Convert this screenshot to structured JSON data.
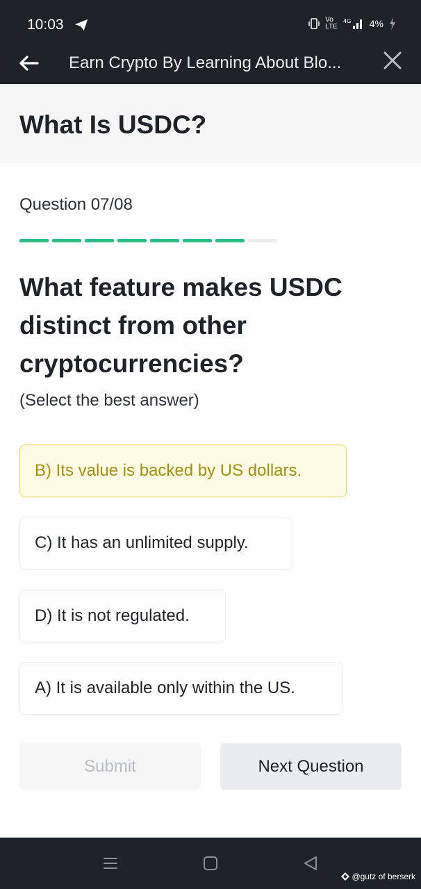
{
  "status_bar": {
    "time": "10:03",
    "indicators": "Ⅱ ⓥ ⁴ᴳ ▕▏",
    "battery": "4%"
  },
  "top_bar": {
    "title": "Earn Crypto By Learning About Blo..."
  },
  "lesson": {
    "title": "What Is USDC?"
  },
  "quiz": {
    "counter": "Question 07/08",
    "progress": {
      "answered": 7,
      "total": 8
    },
    "question": "What feature makes USDC distinct from other cryptocurrencies?",
    "hint": "(Select the best answer)",
    "options": [
      {
        "label": "B) Its value is backed by US dollars.",
        "selected": true
      },
      {
        "label": "C) It has an unlimited supply.",
        "selected": false
      },
      {
        "label": "D) It is not regulated.",
        "selected": false
      },
      {
        "label": "A) It is available only within the US.",
        "selected": false
      }
    ],
    "submit_label": "Submit",
    "next_label": "Next Question"
  },
  "watermark": "@gutz of berserk",
  "colors": {
    "header_bg": "#1e2329",
    "progress_done": "#2ebd85",
    "selected_bg": "#fefbe5",
    "selected_border": "#f0d64d",
    "selected_text": "#a6900f"
  }
}
